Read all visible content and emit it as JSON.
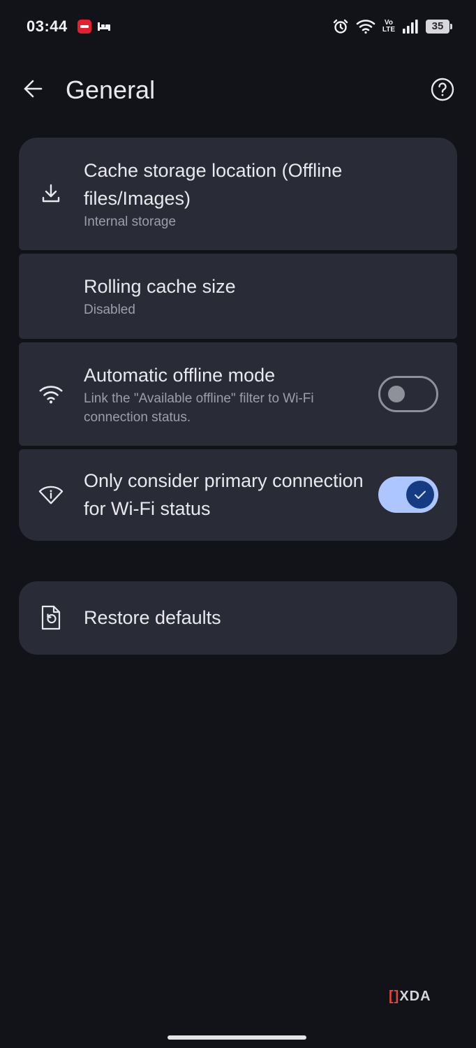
{
  "status_bar": {
    "time": "03:44",
    "network_label_top": "Vo",
    "network_label_bottom": "LTE",
    "battery": "35",
    "icons": [
      "notification-app-icon",
      "bed-icon",
      "alarm-icon",
      "wifi-icon",
      "volte-icon",
      "signal-icon",
      "battery-icon"
    ]
  },
  "app_bar": {
    "title": "General",
    "back_icon": "arrow-back-icon",
    "help_icon": "help-circle-icon"
  },
  "settings": [
    {
      "title": "Cache storage location (Offline files/Images)",
      "summary": "Internal storage",
      "icon": "download-icon"
    },
    {
      "title": "Rolling cache size",
      "summary": "Disabled"
    },
    {
      "title": "Automatic offline mode",
      "summary": "Link the \"Available offline\" filter to Wi-Fi connection status.",
      "icon": "wifi-icon",
      "toggle": false
    },
    {
      "title": "Only consider primary connection for Wi-Fi status",
      "icon": "wifi-info-icon",
      "toggle": true
    }
  ],
  "restore": {
    "label": "Restore defaults",
    "icon": "restore-file-icon"
  },
  "watermark": {
    "bracket": "[]",
    "text": "XDA"
  },
  "colors": {
    "background": "#121318",
    "card": "#292b36",
    "toggle_on_track": "#aec6ff",
    "toggle_on_knob": "#153b82",
    "toggle_off": "#8e909a",
    "primary_text": "#e8e8ee",
    "secondary_text": "#9d9eac"
  }
}
